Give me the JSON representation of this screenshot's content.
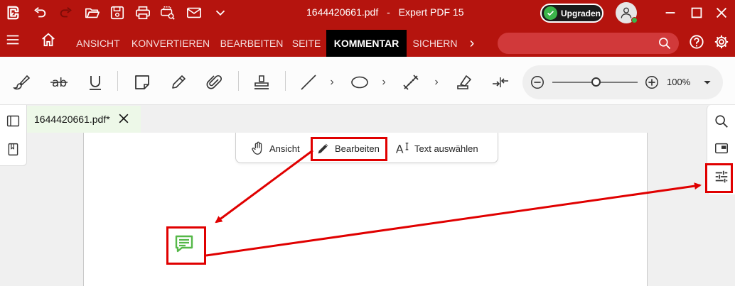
{
  "titlebar": {
    "document_name": "1644420661.pdf",
    "separator": "-",
    "app_name": "Expert PDF 15",
    "upgrade_label": "Upgraden"
  },
  "menu": {
    "tabs": [
      {
        "label": "ANSICHT"
      },
      {
        "label": "KONVERTIEREN"
      },
      {
        "label": "BEARBEITEN"
      },
      {
        "label": "SEITE"
      },
      {
        "label": "KOMMENTAR",
        "active": true
      },
      {
        "label": "SICHERN"
      }
    ],
    "more_label": "›",
    "search_placeholder": ""
  },
  "toolbar": {
    "chevron": "›",
    "zoom": {
      "value_label": "100%",
      "level_percent": 100
    }
  },
  "document_tab": {
    "label": "1644420661.pdf*"
  },
  "mode_bar": {
    "view_label": "Ansicht",
    "edit_label": "Bearbeiten",
    "select_text_label": "Text auswählen"
  },
  "colors": {
    "brand": "#b5140e",
    "active_tab": "#000000",
    "upgrade_check": "#3bb54a",
    "annotation_red": "#e00000",
    "note_green": "#55b848",
    "doc_tab_bg": "#edf8e8"
  }
}
